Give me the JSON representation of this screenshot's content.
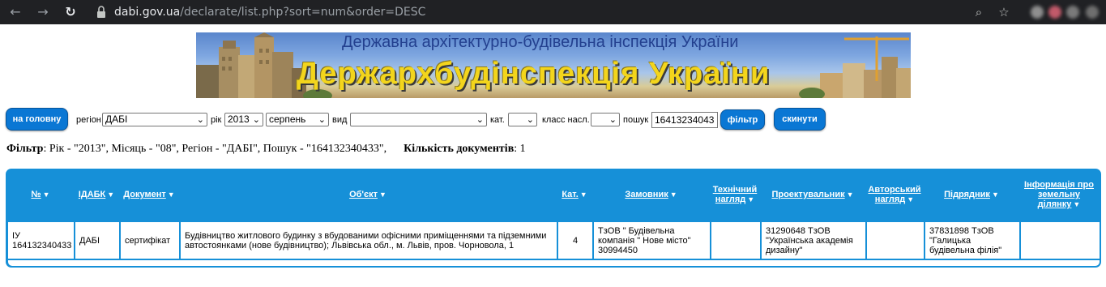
{
  "browser": {
    "back_icon": "arrow-left-icon",
    "forward_icon": "arrow-right-icon",
    "reload_icon": "reload-icon",
    "url_host": "dabi.gov.ua",
    "url_path": "/declarate/list.php?sort=num&order=DESC"
  },
  "banner": {
    "subtitle": "Державна архітектурно-будівельна інспекція України",
    "title": "Держархбудінспекція України"
  },
  "filters": {
    "home_button": "на головну",
    "region_label": "регіон",
    "region_value": "ДАБІ",
    "year_label": "рік",
    "year_value": "2013",
    "month_value": "серпень",
    "type_label": "вид",
    "type_value": "",
    "cat_label": "кат.",
    "cat_value": "",
    "class_label": "класс насл.",
    "class_value": "",
    "search_label": "пошук",
    "search_value": "16413234043",
    "filter_button": "фільтр",
    "reset_button": "скинути"
  },
  "summary": {
    "filter_label": "Фільтр",
    "filter_text": ": Рік - \"2013\", Місяць - \"08\", Регіон - \"ДАБІ\", Пошук - \"164132340433\",",
    "count_label": "Кількість документів",
    "count_value": ": 1"
  },
  "table": {
    "headers": [
      "№",
      "ІДАБК",
      "Документ",
      "Об'єкт",
      "Кат.",
      "Замовник",
      "Технічний нагляд",
      "Проектувальник",
      "Авторський нагляд",
      "Підрядник",
      "Інформація про земельну ділянку"
    ],
    "rows": [
      {
        "num": "ІУ 164132340433",
        "idabk": "ДАБІ",
        "document": "сертифікат",
        "object": "Будівництво житлового будинку з вбудованими офісними приміщеннями та підземними автостоянками (нове будівництво); Львівська обл., м. Львів, пров. Чорновола, 1",
        "cat": "4",
        "customer": "ТзОВ \" Будівельна компанія \" Нове місто\" 30994450",
        "tech_supervision": "",
        "designer": "31290648 ТзОВ \"Українська академія дизайну\"",
        "author_supervision": "",
        "contractor": "37831898 ТзОВ \"Галицька будівельна філія\"",
        "land_info": ""
      }
    ]
  },
  "colors": {
    "table_blue": "#1690d8",
    "button_blue": "#0a77d4",
    "banner_yellow": "#f3d51c"
  }
}
